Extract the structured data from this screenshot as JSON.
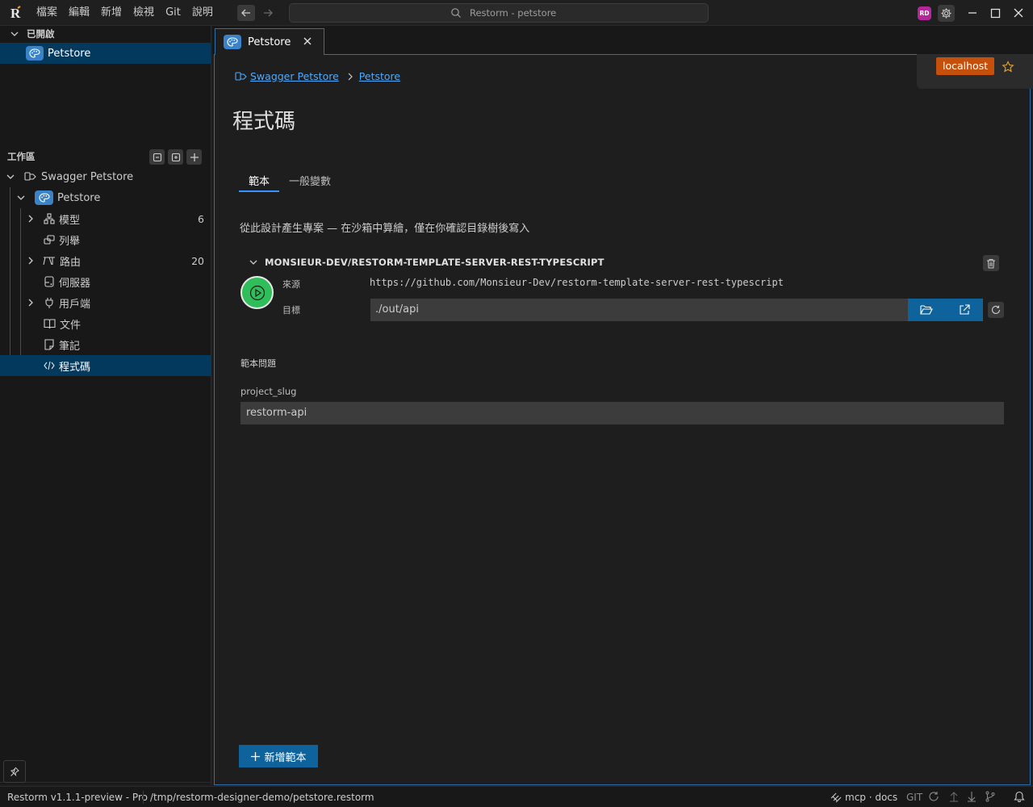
{
  "titlebar": {
    "logo_letter": "R",
    "menu": [
      "檔案",
      "編輯",
      "新增",
      "檢視",
      "Git",
      "說明"
    ],
    "search_text": "Restorm - petstore",
    "avatar_initials": "RD"
  },
  "sidebar": {
    "open_header": "已開啟",
    "open_items": [
      {
        "label": "Petstore",
        "selected": true
      }
    ],
    "workspace_header": "工作區",
    "root": {
      "label": "Swagger Petstore"
    },
    "project": {
      "label": "Petstore"
    },
    "items": [
      {
        "label": "模型",
        "count": "6",
        "expandable": true,
        "icon": "model-icon"
      },
      {
        "label": "列舉",
        "count": "",
        "expandable": false,
        "icon": "enum-icon"
      },
      {
        "label": "路由",
        "count": "20",
        "expandable": true,
        "icon": "route-icon"
      },
      {
        "label": "伺服器",
        "count": "",
        "expandable": false,
        "icon": "server-icon"
      },
      {
        "label": "用戶端",
        "count": "",
        "expandable": true,
        "icon": "client-icon"
      },
      {
        "label": "文件",
        "count": "",
        "expandable": false,
        "icon": "book-icon"
      },
      {
        "label": "筆記",
        "count": "",
        "expandable": false,
        "icon": "note-icon"
      },
      {
        "label": "程式碼",
        "count": "",
        "expandable": false,
        "icon": "code-icon",
        "selected": true
      }
    ]
  },
  "tab": {
    "label": "Petstore"
  },
  "env": {
    "label": "localhost",
    "color": "#c5500c"
  },
  "breadcrumb": {
    "root": "Swagger Petstore",
    "current": "Petstore"
  },
  "page_title": "程式碼",
  "subtabs": [
    {
      "label": "範本",
      "active": true
    },
    {
      "label": "一般變數",
      "active": false
    }
  ],
  "description": "從此設計產生專案 — 在沙箱中算繪，僅在你確認目錄樹後寫入",
  "template": {
    "name": "MONSIEUR-DEV/RESTORM-TEMPLATE-SERVER-REST-TYPESCRIPT",
    "source_label": "來源",
    "source_url": "https://github.com/Monsieur-Dev/restorm-template-server-rest-typescript",
    "target_label": "目標",
    "target_value": "./out/api",
    "questions_title": "範本問題",
    "questions": [
      {
        "label": "project_slug",
        "value": "restorm-api"
      }
    ]
  },
  "add_template_label": "新增範本",
  "statusbar": {
    "version": "Restorm v1.1.1-preview - Pro",
    "path": "/tmp/restorm-designer-demo/petstore.restorm",
    "mcp": "mcp · docs",
    "git": "GIT"
  },
  "colors": {
    "accent": "#0e639c",
    "link": "#4daafc",
    "run": "#2fbe59",
    "selection": "#04395e"
  }
}
